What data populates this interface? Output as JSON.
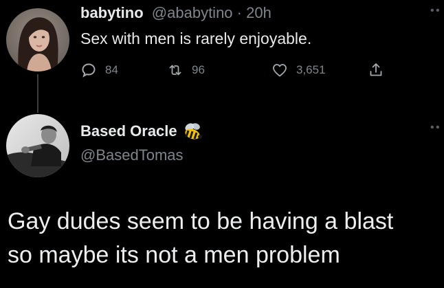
{
  "original_tweet": {
    "display_name": "babytino",
    "handle": "@ababytino",
    "separator": " · ",
    "time": "20h",
    "text": "Sex with men is rarely enjoyable.",
    "avatar_icon": "profile-photo-woman-dark-hair",
    "more_icon": "more-options-icon",
    "actions": {
      "reply": {
        "icon": "reply-bubble-icon",
        "count": "84"
      },
      "retweet": {
        "icon": "retweet-icon",
        "count": "96"
      },
      "like": {
        "icon": "heart-icon",
        "count": "3,651"
      },
      "share": {
        "icon": "share-icon"
      }
    }
  },
  "reply_tweet": {
    "display_name": "Based Oracle",
    "name_emoji": "bee-emoji-icon",
    "handle": "@BasedTomas",
    "text_lines": [
      "Gay dudes seem to be having a blast",
      "so maybe its not a men problem"
    ],
    "avatar_icon": "profile-photo-man-black-white",
    "more_icon": "more-options-icon"
  },
  "colors": {
    "background": "#000000",
    "primary_text": "#e7e9ea",
    "secondary_text": "#7f868b",
    "thread_line": "#3a3e41"
  }
}
